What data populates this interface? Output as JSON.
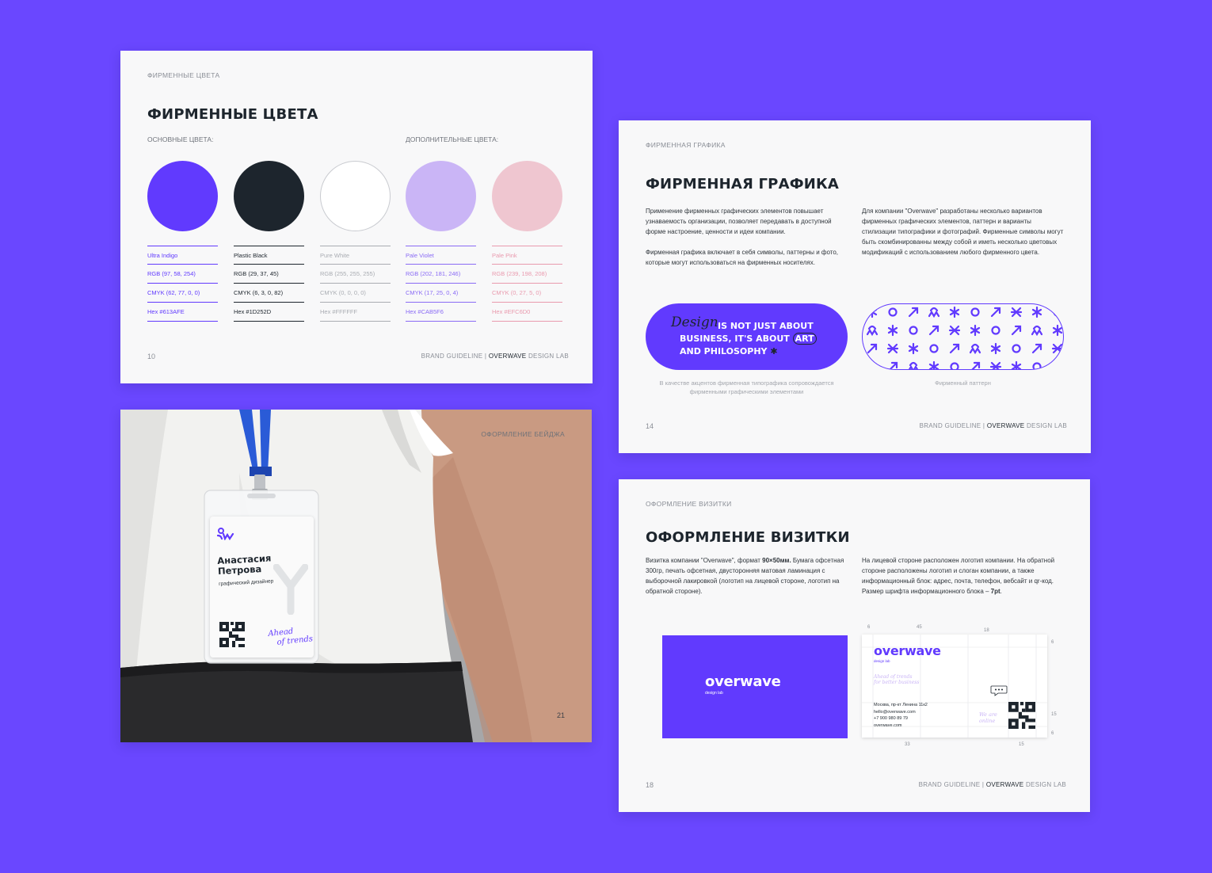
{
  "colors_slide": {
    "eyebrow": "ФИРМЕННЫЕ ЦВЕТА",
    "title": "ФИРМЕННЫЕ ЦВЕТА",
    "primary_label": "ОСНОВНЫЕ ЦВЕТА:",
    "secondary_label": "ДОПОЛНИТЕЛЬНЫЕ ЦВЕТА:",
    "page": "10",
    "footer_a": "BRAND GUIDELINE | ",
    "footer_b": "OVERWAVE",
    "footer_c": " DESIGN LAB",
    "swatches": [
      {
        "name": "Ultra Indigo",
        "rgb": "RGB (97, 58, 254)",
        "cmyk": "CMYK (62, 77, 0, 0)",
        "hex": "Hex #613AFE",
        "color": "#613AFE",
        "text_color": "#613AFE"
      },
      {
        "name": "Plastic Black",
        "rgb": "RGB (29, 37, 45)",
        "cmyk": "CMYK (6, 3, 0, 82)",
        "hex": "Hex #1D252D",
        "color": "#1D252D",
        "text_color": "#1D252D"
      },
      {
        "name": "Pure White",
        "rgb": "RGB (255, 255, 255)",
        "cmyk": "CMYK (0, 0, 0, 0)",
        "hex": "Hex #FFFFFF",
        "color": "#FFFFFF",
        "text_color": "#A9ACB2"
      },
      {
        "name": "Pale Violet",
        "rgb": "RGB (202, 181, 246)",
        "cmyk": "CMYK (17, 25, 0, 4)",
        "hex": "Hex #CAB5F6",
        "color": "#CAB5F6",
        "text_color": "#8A6BF5"
      },
      {
        "name": "Pale Pink",
        "rgb": "RGB (239, 198, 208)",
        "cmyk": "CMYK (0, 27, 5, 0)",
        "hex": "Hex #EFC6D0",
        "color": "#EFC6D0",
        "text_color": "#E99AAE"
      }
    ]
  },
  "badge_slide": {
    "eyebrow": "ОФОРМЛЕНИЕ БЕЙДЖА",
    "page": "21",
    "first_name": "Анастасия",
    "last_name": "Петрова",
    "role": "графический дизайнер",
    "slogan_1": "Ahead",
    "slogan_2": "of trends"
  },
  "graphics_slide": {
    "eyebrow": "ФИРМЕННАЯ ГРАФИКА",
    "title": "ФИРМЕННАЯ ГРАФИКА",
    "para_left_1": "Применение фирменных графических элементов повышает узнаваемость организации, позволяет передавать в доступной форме настроение, ценности и идеи компании.",
    "para_left_2": "Фирменная графика включает в себя символы, паттерны и фото, которые могут использоваться на фирменных носителях.",
    "para_right": "Для компании \"Overwave\" разработаны несколько вариантов фирменных графических элементов, паттерн и варианты стилизации типографики и фотографий. Фирменные символы могут быть скомбинированны между собой и иметь несколько цветовых модификаций с использованием любого фирменного цвета.",
    "script_word": "Design",
    "slogan_line1": "IS NOT JUST ABOUT",
    "slogan_line2a": "BUSINESS, IT'S ABOUT ",
    "slogan_line2b": "ART",
    "slogan_line3": "AND PHILOSOPHY",
    "caption_left": "В качестве акцентов фирменная типографика сопровождается фирменными графическими элементами",
    "caption_right": "Фирменный паттерн",
    "page": "14",
    "footer_a": "BRAND GUIDELINE | ",
    "footer_b": "OVERWAVE",
    "footer_c": " DESIGN LAB"
  },
  "card_slide": {
    "eyebrow": "ОФОРМЛЕНИЕ ВИЗИТКИ",
    "title": "ОФОРМЛЕНИЕ ВИЗИТКИ",
    "para_left_a": "Визитка компании \"Overwave\", формат ",
    "para_left_b": "90×50мм.",
    "para_left_c": " Бумага офсетная 300гр, печать офсетная, двусторонняя матовая ламинация с выборочной лакировкой (логотип на лицевой стороне, логотип на обратной стороне).",
    "para_right_a": "На лицевой стороне расположен логотип компании. На обратной стороне расположены логотип и слоган компании, а также информационный блок: адрес, почта, телефон, вебсайт и qr-код. Размер шрифта информационного блока – ",
    "para_right_b": "7pt",
    "para_right_c": ".",
    "logo": "overwave",
    "logo_sub": "design lab",
    "back_slogan_1": "Ahead of trends",
    "back_slogan_2": "for better business",
    "address": "Москва, пр-кт Ленина 11к2",
    "email": "hello@overwave.com",
    "phone": "+7 900 980 89 79",
    "website": "overwave.com",
    "we_are_1": "We are",
    "we_are_2": "online",
    "dims": {
      "d6a": "6",
      "d45": "45",
      "d18": "18",
      "d6b": "6",
      "d15a": "15",
      "d6c": "6",
      "d33": "33",
      "d15b": "15"
    },
    "page": "18",
    "footer_a": "BRAND GUIDELINE | ",
    "footer_b": "OVERWAVE",
    "footer_c": " DESIGN LAB"
  }
}
